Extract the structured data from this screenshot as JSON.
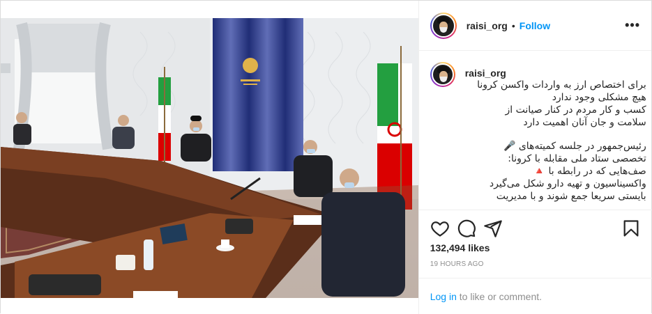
{
  "post": {
    "username": "raisi_org",
    "separator": "•",
    "follow_label": "Follow",
    "more_label": "•••",
    "caption_user": "raisi_org",
    "caption_lines": [
      "برای اختصاص ارز به واردات واکسن کرونا",
      "هیچ مشکلی وجود ندارد",
      "کسب و کار مردم در کنار صیانت از",
      "سلامت و جان آنان اهمیت دارد",
      "",
      "رئیس‌جمهور در جلسه کمیته‌های 🎤",
      "تخصصی ستاد ملی مقابله با کرونا:",
      "صف‌هایی که در رابطه با 🔺",
      "واکسیناسیون و تهیه دارو شکل می‌گیرد",
      "بایستی سریعا جمع شوند و با مدیریت"
    ],
    "likes": "132,494 likes",
    "time": "19 HOURS AGO",
    "login_link": "Log in",
    "login_rest": " to like or comment."
  },
  "icons": {
    "like": "heart-icon",
    "comment": "comment-icon",
    "share": "share-icon",
    "save": "bookmark-icon",
    "more": "more-options-icon"
  },
  "colors": {
    "link": "#0095f6",
    "text": "#262626",
    "muted": "#8e8e8e",
    "curtain_blue": "#2b3d9e"
  }
}
